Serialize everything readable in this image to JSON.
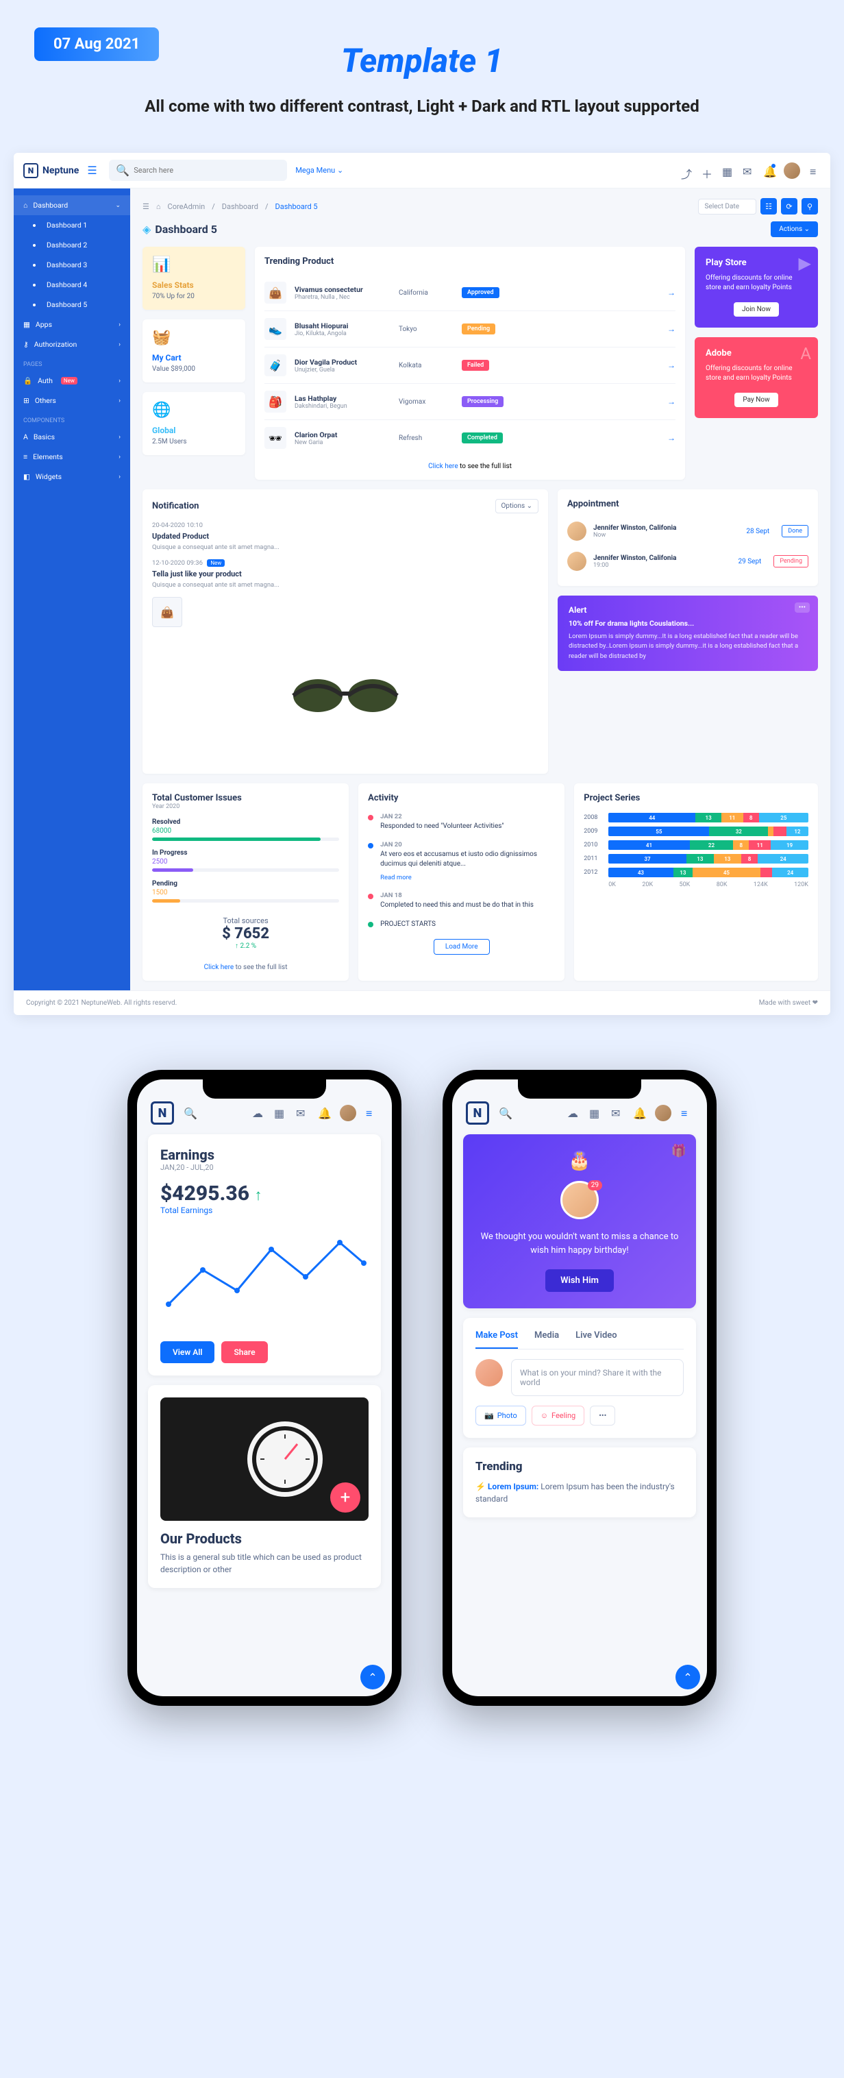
{
  "hero": {
    "date": "07 Aug 2021",
    "title": "Template 1",
    "subtitle": "All come with two different contrast, Light + Dark and RTL layout supported"
  },
  "header": {
    "brand": "Neptune",
    "search_ph": "Search here",
    "mega": "Mega Menu"
  },
  "sidebar": {
    "items": [
      {
        "icon": "⌂",
        "label": "Dashboard",
        "chev": "⌄",
        "active": true
      },
      {
        "sub": true,
        "label": "Dashboard 1"
      },
      {
        "sub": true,
        "label": "Dashboard 2"
      },
      {
        "sub": true,
        "label": "Dashboard 3"
      },
      {
        "sub": true,
        "label": "Dashboard 4"
      },
      {
        "sub": true,
        "label": "Dashboard 5",
        "on": true
      },
      {
        "icon": "▦",
        "label": "Apps",
        "chev": "›"
      },
      {
        "icon": "⚷",
        "label": "Authorization",
        "chev": "›"
      }
    ],
    "pages_label": "Pages",
    "pages": [
      {
        "icon": "🔒",
        "label": "Auth",
        "badge": "New",
        "chev": "›"
      },
      {
        "icon": "⊞",
        "label": "Others",
        "chev": "›"
      }
    ],
    "comp_label": "Components",
    "comps": [
      {
        "icon": "A",
        "label": "Basics",
        "chev": "›"
      },
      {
        "icon": "≡",
        "label": "Elements",
        "chev": "›"
      },
      {
        "icon": "◧",
        "label": "Widgets",
        "chev": "›"
      }
    ]
  },
  "breadcrumb": {
    "a": "CoreAdmin",
    "b": "Dashboard",
    "c": "Dashboard 5",
    "select": "Select Date"
  },
  "page_title": "Dashboard 5",
  "actions": "Actions",
  "stats": [
    {
      "icon": "📊",
      "title": "Sales Stats",
      "sub": "70% Up for 20",
      "cls": "yellow",
      "color": "#e6a23c"
    },
    {
      "icon": "🧺",
      "title": "My Cart",
      "sub": "Value $89,000",
      "cls": "",
      "color": "#0d6efd"
    },
    {
      "icon": "🌐",
      "title": "Global",
      "sub": "2.5M Users",
      "cls": "",
      "color": "#38bdf8"
    }
  ],
  "trending": {
    "title": "Trending Product",
    "footer_a": "Click here",
    "footer_b": " to see the full list",
    "rows": [
      {
        "thumb": "👜",
        "name": "Vivamus consectetur",
        "sub": "Pharetra, Nulla , Nec",
        "city": "California",
        "badge": "Approved",
        "bcls": "b-app"
      },
      {
        "thumb": "👟",
        "name": "Blusaht Hiopurai",
        "sub": "Jio, Kilukta, Angola",
        "city": "Tokyo",
        "badge": "Pending",
        "bcls": "b-pen"
      },
      {
        "thumb": "🧳",
        "name": "Dior Vagila Product",
        "sub": "Unujzier, Guela",
        "city": "Kolkata",
        "badge": "Failed",
        "bcls": "b-fail"
      },
      {
        "thumb": "🎒",
        "name": "Las Hathplay",
        "sub": "Dakshindari, Begun",
        "city": "Vigomax",
        "badge": "Processing",
        "bcls": "b-proc"
      },
      {
        "thumb": "🕶",
        "name": "Clarion Orpat",
        "sub": "New Garia",
        "city": "Refresh",
        "badge": "Completed",
        "bcls": "b-comp"
      }
    ]
  },
  "promos": [
    {
      "cls": "purple",
      "icon": "▶",
      "title": "Play Store",
      "text": "Offering discounts for online store and earn loyalty Points",
      "btn": "Join Now"
    },
    {
      "cls": "red",
      "icon": "A",
      "title": "Adobe",
      "text": "Offering discounts for online store and earn loyalty Points",
      "btn": "Pay Now"
    }
  ],
  "notif": {
    "title": "Notification",
    "options": "Options",
    "items": [
      {
        "date": "20-04-2020 10:10",
        "title": "Updated Product",
        "text": "Quisque a consequat ante sit amet magna..."
      },
      {
        "date": "12-10-2020 09:36",
        "badge": "New",
        "title": "Tella just like your product",
        "text": "Quisque a consequat ante sit amet magna..."
      }
    ]
  },
  "appt": {
    "title": "Appointment",
    "rows": [
      {
        "name": "Jennifer Winston, Califonia",
        "time": "Now",
        "date": "28 Sept",
        "status": "Done",
        "scls": "ab-done"
      },
      {
        "name": "Jennifer Winston, Califonia",
        "time": "19:00",
        "date": "29 Sept",
        "status": "Pending",
        "scls": "ab-pen"
      }
    ]
  },
  "alert": {
    "h": "Alert",
    "title": "10% off For drama lights Couslations...",
    "text": "Lorem Ipsum is simply dummy...It is a long established fact that a reader will be distracted by..Lorem Ipsum is simply dummy...it is a long established fact that a reader will be distracted by"
  },
  "issues": {
    "title": "Total Customer Issues",
    "year": "Year 2020",
    "items": [
      {
        "label": "Resolved",
        "val": "68000",
        "color": "#10b981",
        "pct": 90,
        "vcls": "v-green"
      },
      {
        "label": "In Progress",
        "val": "2500",
        "color": "#8b5cf6",
        "pct": 22,
        "vcls": "v-purple"
      },
      {
        "label": "Pending",
        "val": "1500",
        "color": "#ffa940",
        "pct": 15,
        "vcls": "v-orange"
      }
    ],
    "total_lbl": "Total sources",
    "total": "$ 7652",
    "pct": "↑ 2.2 %",
    "footer_a": "Click here",
    "footer_b": " to see the full list"
  },
  "activity": {
    "title": "Activity",
    "load": "Load More",
    "items": [
      {
        "dot": "ad-red",
        "date": "JAN 22",
        "text": "Responded to need \"Volunteer Activities\""
      },
      {
        "dot": "ad-blue",
        "date": "JAN 20",
        "text": "At vero eos et accusamus et iusto odio dignissimos ducimus qui deleniti atque...",
        "link": "Read more"
      },
      {
        "dot": "ad-red",
        "date": "JAN 18",
        "text": "Completed to need this and must be do that in this"
      },
      {
        "dot": "ad-green",
        "date": "",
        "text": "PROJECT STARTS"
      }
    ]
  },
  "chart_data": {
    "title": "Project Series",
    "type": "bar",
    "categories": [
      "2008",
      "2009",
      "2010",
      "2011",
      "2012"
    ],
    "series": [
      {
        "values": [
          44,
          55,
          41,
          37,
          43
        ],
        "color": "#0d6efd"
      },
      {
        "values": [
          13,
          32,
          22,
          13,
          13
        ],
        "color": "#10b981"
      },
      {
        "values": [
          11,
          3,
          8,
          13,
          45
        ],
        "color": "#ffa940"
      },
      {
        "values": [
          8,
          7,
          11,
          8,
          8
        ],
        "color": "#ff4d6d"
      },
      {
        "values": [
          25,
          12,
          19,
          24,
          24
        ],
        "color": "#38bdf8"
      }
    ],
    "labels": [
      [
        "44",
        "13",
        "11",
        "8",
        "25"
      ],
      [
        "55",
        "32",
        "",
        "",
        "12"
      ],
      [
        "41",
        "22",
        "8",
        "11",
        "19"
      ],
      [
        "37",
        "13",
        "13",
        "8",
        "24"
      ],
      [
        "43",
        "13",
        "45",
        "",
        "24"
      ]
    ],
    "axis": [
      "0K",
      "20K",
      "50K",
      "80K",
      "124K",
      "120K"
    ]
  },
  "footer": {
    "left": "Copyright © 2021 NeptuneWeb. All rights reservd.",
    "right": "Made with sweet ❤"
  },
  "phone1": {
    "earn": {
      "h": "Earnings",
      "sub": "JAN,20 - JUL,20",
      "val": "$4295.36",
      "lbl": "Total Earnings",
      "va": "View All",
      "sh": "Share"
    },
    "prod": {
      "h": "Our Products",
      "p": "This is a general sub title which can be used as product description or other"
    }
  },
  "phone2": {
    "bday": {
      "text": "We thought you wouldn't want to miss a chance to wish him happy birthday!",
      "btn": "Wish Him"
    },
    "tabs": [
      "Make Post",
      "Media",
      "Live Video"
    ],
    "post_ph": "What is on your mind? Share it with the world",
    "chips": {
      "photo": "Photo",
      "feel": "Feeling",
      "more": "•••"
    },
    "trend": {
      "h": "Trending",
      "item_b": "Lorem Ipsum:",
      "item_t": " Lorem Ipsum has been the industry's standard"
    }
  }
}
